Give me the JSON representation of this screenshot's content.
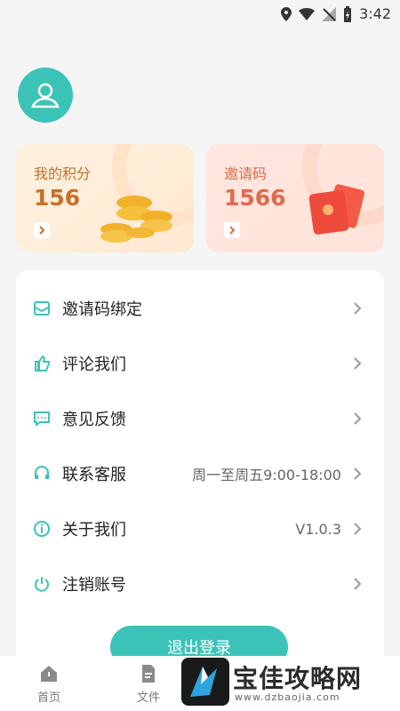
{
  "status_bar": {
    "time": "3:42"
  },
  "profile": {
    "avatar": "user-icon"
  },
  "cards": {
    "points": {
      "label": "我的积分",
      "value": "156"
    },
    "invite": {
      "label": "邀请码",
      "value": "1566"
    }
  },
  "menu": {
    "items": [
      {
        "label": "邀请码绑定",
        "value": "",
        "icon": "mail-icon"
      },
      {
        "label": "评论我们",
        "value": "",
        "icon": "thumbs-up-icon"
      },
      {
        "label": "意见反馈",
        "value": "",
        "icon": "feedback-icon"
      },
      {
        "label": "联系客服",
        "value": "周一至周五9:00-18:00",
        "icon": "headset-icon"
      },
      {
        "label": "关于我们",
        "value": "V1.0.3",
        "icon": "info-icon"
      },
      {
        "label": "注销账号",
        "value": "",
        "icon": "power-icon"
      }
    ]
  },
  "logout_button": {
    "label": "退出登录"
  },
  "bottom_nav": [
    {
      "label": "首页"
    },
    {
      "label": "文件"
    }
  ],
  "watermark": {
    "title": "宝佳攻略网",
    "url": "www.dzbaojia.com"
  },
  "colors": {
    "accent": "#3cc3b8",
    "points": "#c6702a",
    "invite": "#e06a4f"
  }
}
